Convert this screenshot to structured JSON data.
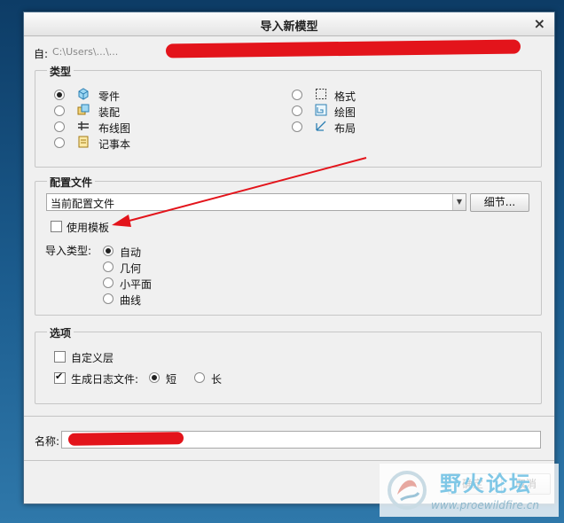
{
  "window": {
    "title": "导入新模型",
    "close_glyph": "×"
  },
  "source": {
    "label": "自:",
    "path_visible": "C:\\Users\\...\\...",
    "redacted": true
  },
  "type_group": {
    "title": "类型",
    "options": [
      {
        "label": "零件",
        "icon": "part-icon",
        "selected": true
      },
      {
        "label": "装配",
        "icon": "assembly-icon",
        "selected": false
      },
      {
        "label": "布线图",
        "icon": "wiring-diagram-icon",
        "selected": false
      },
      {
        "label": "记事本",
        "icon": "notebook-icon",
        "selected": false
      },
      {
        "label": "格式",
        "icon": "format-icon",
        "selected": false
      },
      {
        "label": "绘图",
        "icon": "drawing-icon",
        "selected": false
      },
      {
        "label": "布局",
        "icon": "layout-icon",
        "selected": false
      }
    ]
  },
  "profile_group": {
    "title": "配置文件",
    "profile_value": "当前配置文件",
    "details_button": "细节...",
    "use_template_label": "使用模板",
    "use_template_checked": false,
    "import_type_label": "导入类型:",
    "import_types": [
      {
        "label": "自动",
        "selected": true
      },
      {
        "label": "几何",
        "selected": false
      },
      {
        "label": "小平面",
        "selected": false
      },
      {
        "label": "曲线",
        "selected": false
      }
    ]
  },
  "options_group": {
    "title": "选项",
    "custom_layer_label": "自定义层",
    "custom_layer_checked": false,
    "log_label": "生成日志文件:",
    "log_checked": true,
    "log_short_label": "短",
    "log_short_selected": true,
    "log_long_label": "长",
    "log_long_selected": false
  },
  "name_field": {
    "label": "名称:",
    "value": "",
    "redacted": true
  },
  "footer": {
    "ok_label": "确定",
    "cancel_label": "取消"
  },
  "watermark": {
    "brand_cn": "野火论坛",
    "url": "www.proewildfire.cn"
  },
  "colors": {
    "annotation_red": "#e3141b",
    "desktop_blue": "#1c5d8f"
  }
}
